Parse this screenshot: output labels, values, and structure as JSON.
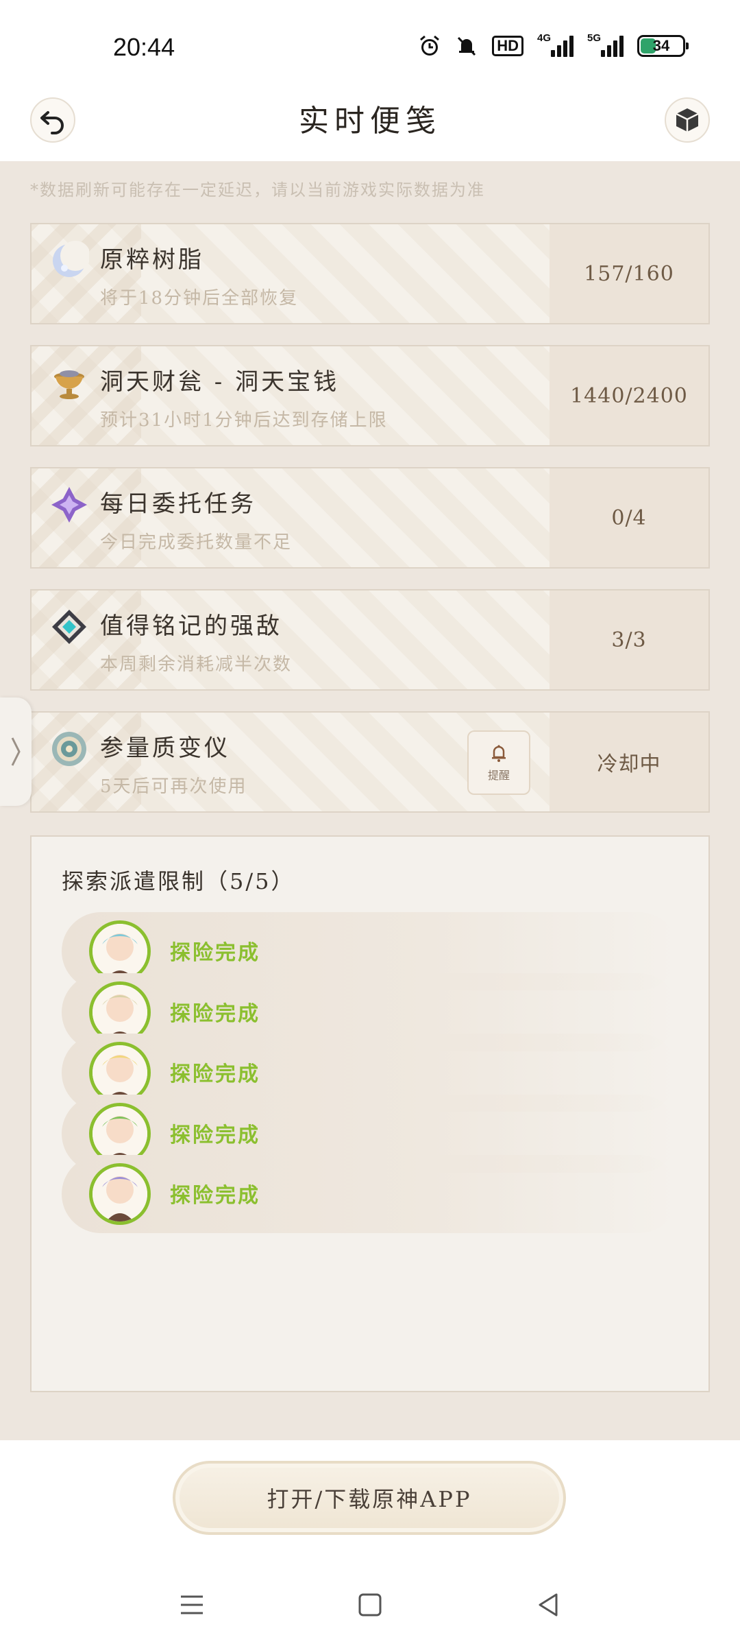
{
  "status_bar": {
    "time": "20:44",
    "icons": [
      "alarm-icon",
      "mute-icon"
    ],
    "hd": "HD",
    "network_1": "4G",
    "network_2": "5G",
    "battery": "34",
    "battery_level": 0.34
  },
  "header": {
    "title": "实时便笺",
    "back_icon": "back-arrow-icon",
    "cube_icon": "cube-icon"
  },
  "note": "*数据刷新可能存在一定延迟，请以当前游戏实际数据为准",
  "cards": [
    {
      "title": "原粹树脂",
      "subtitle": "将于18分钟后全部恢复",
      "value": "157/160",
      "icon": "resin-moon-icon"
    },
    {
      "title": "洞天财瓮 - 洞天宝钱",
      "subtitle": "预计31小时1分钟后达到存储上限",
      "value": "1440/2400",
      "icon": "realm-currency-icon"
    },
    {
      "title": "每日委托任务",
      "subtitle": "今日完成委托数量不足",
      "value": "0/4",
      "icon": "commission-icon"
    },
    {
      "title": "值得铭记的强敌",
      "subtitle": "本周剩余消耗减半次数",
      "value": "3/3",
      "icon": "weekly-boss-icon"
    },
    {
      "title": "参量质变仪",
      "subtitle": "5天后可再次使用",
      "value": "冷却中",
      "icon": "transformer-icon",
      "remind_label": "提醒"
    }
  ],
  "expedition": {
    "title": "探索派遣限制（5/5）",
    "items": [
      {
        "status": "探险完成",
        "avatar_color": "#7fc9d8"
      },
      {
        "status": "探险完成",
        "avatar_color": "#d9d2a8"
      },
      {
        "status": "探险完成",
        "avatar_color": "#f1d77a"
      },
      {
        "status": "探险完成",
        "avatar_color": "#7cc25a"
      },
      {
        "status": "探险完成",
        "avatar_color": "#9b8fd6"
      }
    ]
  },
  "bottom": {
    "open_button": "打开/下载原神APP"
  },
  "colors": {
    "accent_green": "#8bbf2f",
    "page_bg": "#ede6de",
    "card_value_bg": "#ece3d8"
  }
}
